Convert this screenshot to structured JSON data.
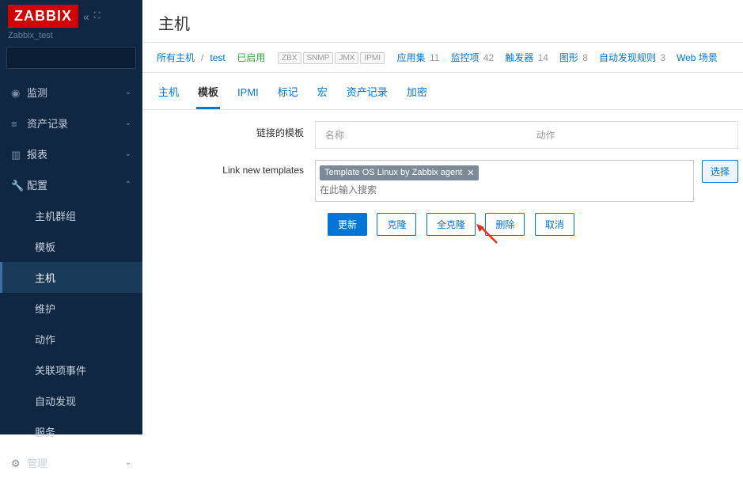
{
  "sidebar": {
    "logo": "ZABBIX",
    "server": "Zabbix_test",
    "nav": [
      {
        "icon": "◉",
        "label": "监测",
        "expanded": false
      },
      {
        "icon": "≡",
        "label": "资产记录",
        "expanded": false
      },
      {
        "icon": "▥",
        "label": "报表",
        "expanded": false
      },
      {
        "icon": "🔧",
        "label": "配置",
        "expanded": true,
        "sub": [
          "主机群组",
          "模板",
          "主机",
          "维护",
          "动作",
          "关联项事件",
          "自动发现",
          "服务"
        ],
        "activeSub": 2
      },
      {
        "icon": "⚙",
        "label": "管理",
        "expanded": false
      }
    ]
  },
  "page": {
    "title": "主机",
    "breadcrumb": {
      "allHosts": "所有主机",
      "host": "test",
      "status": "已启用",
      "tags": [
        "ZBX",
        "SNMP",
        "JMX",
        "IPMI"
      ],
      "links": [
        {
          "label": "应用集",
          "count": 11
        },
        {
          "label": "监控项",
          "count": 42
        },
        {
          "label": "触发器",
          "count": 14
        },
        {
          "label": "图形",
          "count": 8
        },
        {
          "label": "自动发现规则",
          "count": 3
        },
        {
          "label": "Web 场景",
          "count": ""
        }
      ]
    },
    "tabs": [
      "主机",
      "模板",
      "IPMI",
      "标记",
      "宏",
      "资产记录",
      "加密"
    ],
    "activeTab": 1,
    "form": {
      "linkedLabel": "链接的模板",
      "linkedHeaders": {
        "name": "名称",
        "action": "动作"
      },
      "linkNewLabel": "Link new templates",
      "template": "Template OS Linux by Zabbix agent",
      "searchPlaceholder": "在此输入搜索",
      "selectBtn": "选择"
    },
    "buttons": {
      "update": "更新",
      "clone": "克隆",
      "fullClone": "全克隆",
      "delete": "删除",
      "cancel": "取消"
    }
  }
}
